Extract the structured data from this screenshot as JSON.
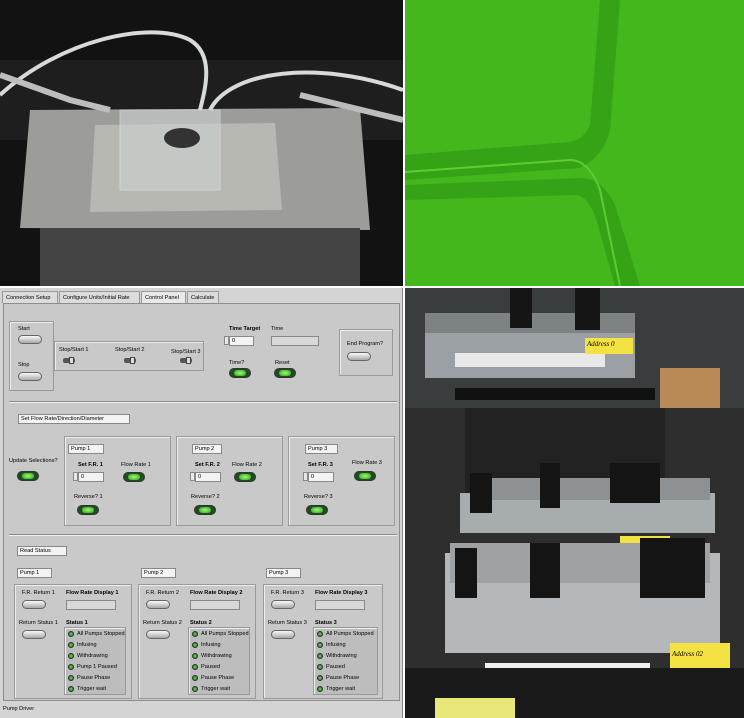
{
  "tabs": [
    "Connection Setup",
    "Configure Units/Initial Rate",
    "Control Panel",
    "Calculate"
  ],
  "active_tab": "Control Panel",
  "control": {
    "start": "Start",
    "stop": "Stop",
    "stop_start_1": "Stop/Start 1",
    "stop_start_2": "Stop/Start 2",
    "stop_start_3": "Stop/Start 3",
    "time_target": "Time Target",
    "time_target_value": "0",
    "time": "Time",
    "time_q": "Time?",
    "reset": "Reset",
    "end_program": "End Program?"
  },
  "flow": {
    "section": "Set Flow Rate/Direction/Diameter",
    "update": "Update Selections?",
    "pumps": [
      {
        "name": "Pump 1",
        "set_fr": "Set F.R. 1",
        "fr_value": "0",
        "flow_rate": "Flow Rate 1",
        "reverse": "Reverse? 1"
      },
      {
        "name": "Pump 2",
        "set_fr": "Set F.R. 2",
        "fr_value": "0",
        "flow_rate": "Flow Rate 2",
        "reverse": "Reverse? 2"
      },
      {
        "name": "Pump 3",
        "set_fr": "Set F.R. 3",
        "fr_value": "0",
        "flow_rate": "Flow Rate 3",
        "reverse": "Reverse? 3"
      }
    ]
  },
  "read": {
    "section": "Read Status",
    "pumps": [
      {
        "name": "Pump 1",
        "fr_return": "F.R. Return 1",
        "display": "Flow Rate Display 1",
        "return_status": "Return Status 1",
        "status": "Status 1"
      },
      {
        "name": "Pump 2",
        "fr_return": "F.R. Return 2",
        "display": "Flow Rate Display 2",
        "return_status": "Return Status 2",
        "status": "Status 2"
      },
      {
        "name": "Pump 3",
        "fr_return": "F.R. Return 3",
        "display": "Flow Rate Display 3",
        "return_status": "Return Status 3",
        "status": "Status 3"
      }
    ],
    "status_items": [
      "All Pumps Stopped",
      "Infusing",
      "Withdrawing",
      "Pump 1 Paused",
      "Pause Phase",
      "Trigger wait"
    ],
    "status_items_2": [
      "All Pumps Stopped",
      "Infusing",
      "Withdrawing",
      "Paused",
      "Pause Phase",
      "Trigger wait"
    ]
  },
  "statusbar": "Pump Driver",
  "photos": {
    "tr_label": "Address 0",
    "br_label": "Address 02"
  }
}
